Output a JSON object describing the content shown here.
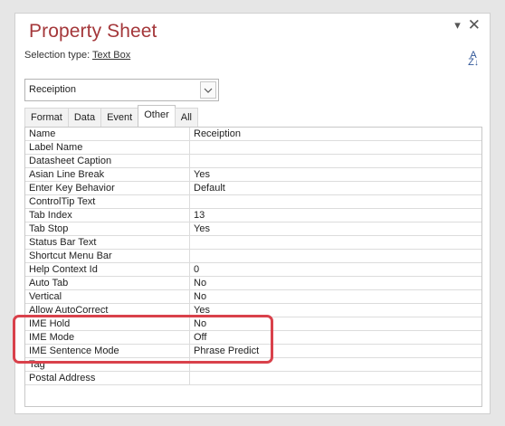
{
  "title": "Property Sheet",
  "selection": {
    "label": "Selection type:",
    "value": "Text Box"
  },
  "combo": {
    "value": "Receiption"
  },
  "tabs": [
    {
      "label": "Format",
      "active": false
    },
    {
      "label": "Data",
      "active": false
    },
    {
      "label": "Event",
      "active": false
    },
    {
      "label": "Other",
      "active": true
    },
    {
      "label": "All",
      "active": false
    }
  ],
  "properties": [
    {
      "name": "Name",
      "value": "Receiption"
    },
    {
      "name": "Label Name",
      "value": ""
    },
    {
      "name": "Datasheet Caption",
      "value": ""
    },
    {
      "name": "Asian Line Break",
      "value": "Yes"
    },
    {
      "name": "Enter Key Behavior",
      "value": "Default"
    },
    {
      "name": "ControlTip Text",
      "value": ""
    },
    {
      "name": "Tab Index",
      "value": "13"
    },
    {
      "name": "Tab Stop",
      "value": "Yes"
    },
    {
      "name": "Status Bar Text",
      "value": ""
    },
    {
      "name": "Shortcut Menu Bar",
      "value": ""
    },
    {
      "name": "Help Context Id",
      "value": "0"
    },
    {
      "name": "Auto Tab",
      "value": "No"
    },
    {
      "name": "Vertical",
      "value": "No"
    },
    {
      "name": "Allow AutoCorrect",
      "value": "Yes"
    },
    {
      "name": "IME Hold",
      "value": "No"
    },
    {
      "name": "IME Mode",
      "value": "Off"
    },
    {
      "name": "IME Sentence Mode",
      "value": "Phrase Predict"
    },
    {
      "name": "Tag",
      "value": ""
    },
    {
      "name": "Postal Address",
      "value": ""
    }
  ],
  "icons": {
    "dropdown": "chevron-down-icon",
    "close": "close-icon",
    "menu": "triangle-down-icon",
    "sort": "sort-az-icon"
  },
  "colors": {
    "title": "#a4373a",
    "highlight": "#d9414b"
  }
}
